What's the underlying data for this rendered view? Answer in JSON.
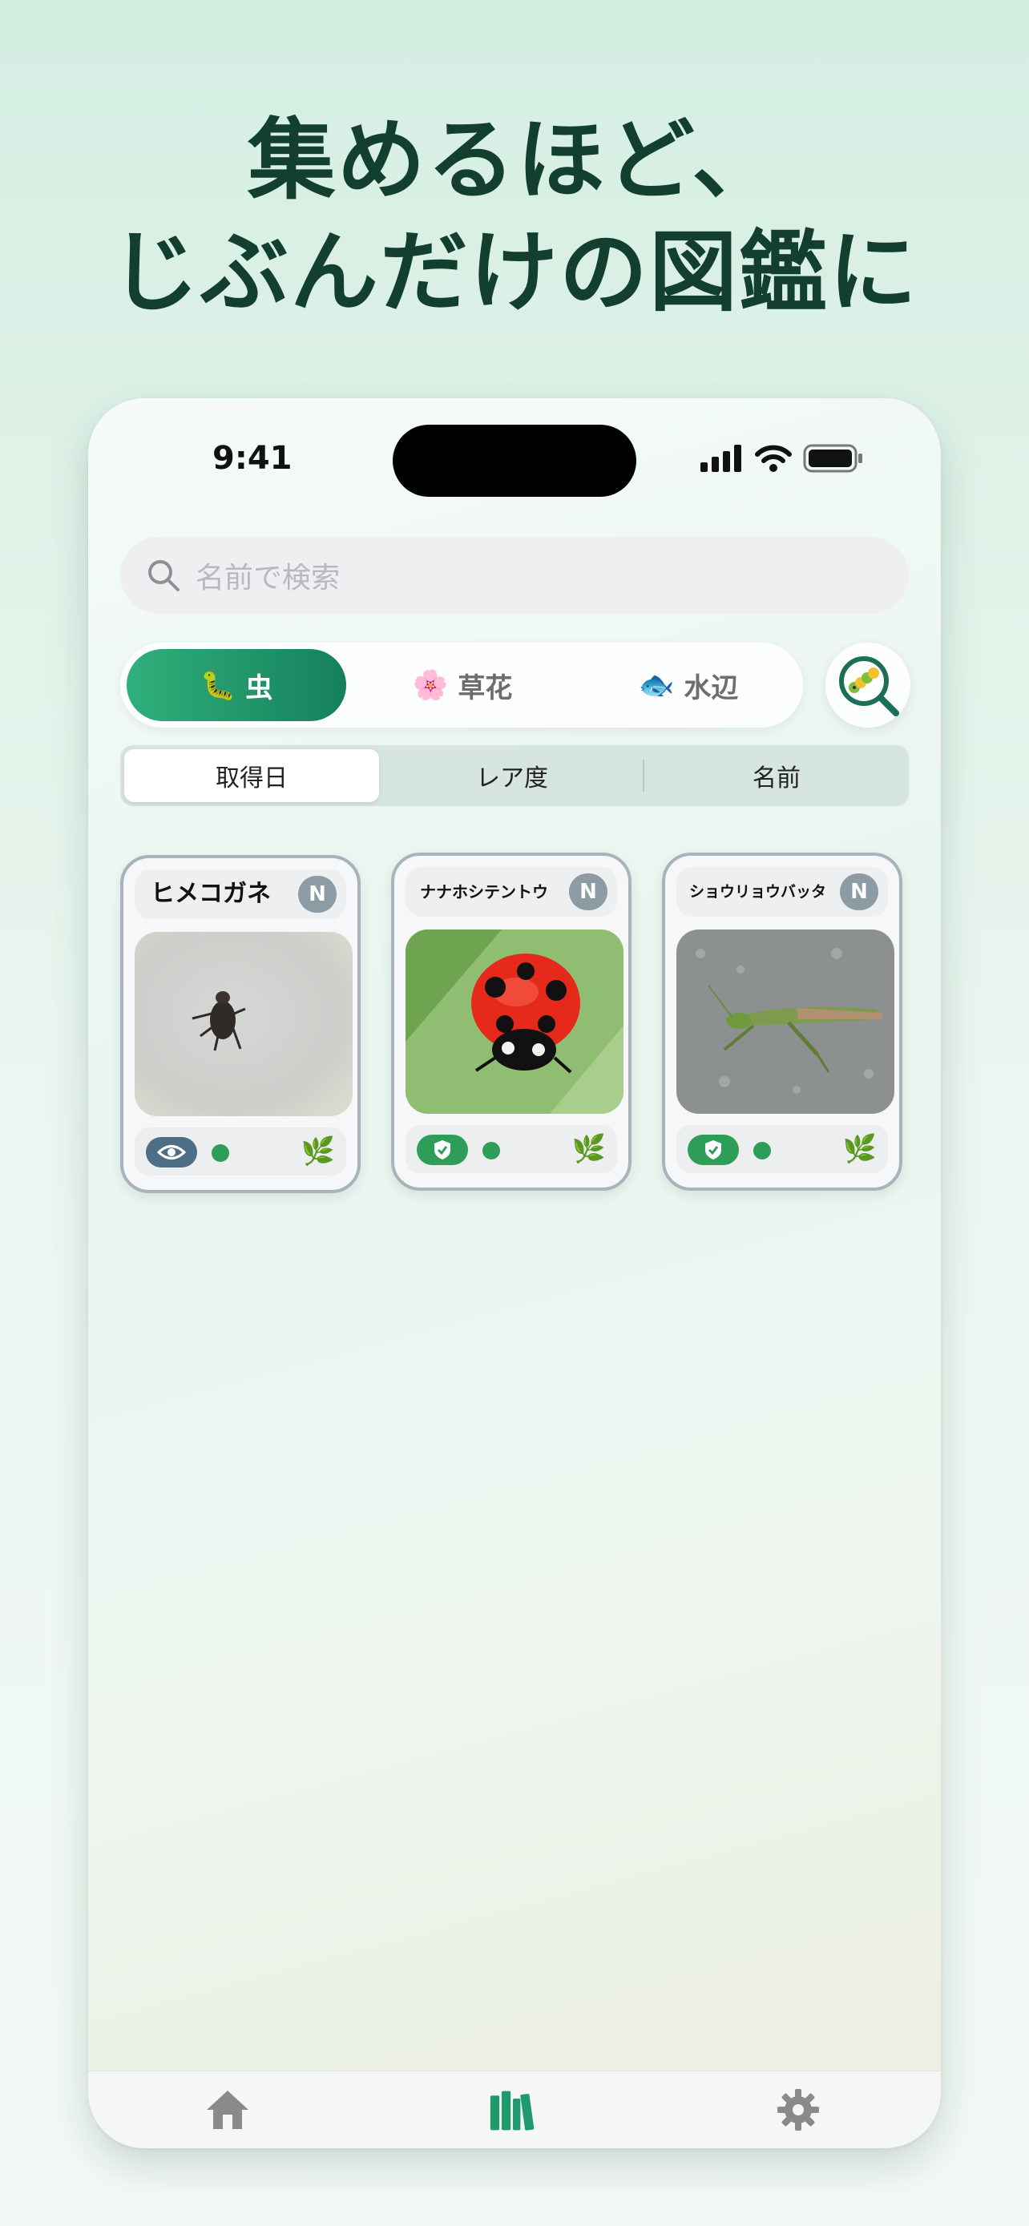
{
  "headline": {
    "line1": "集めるほど、",
    "line2": "じぶんだけの図鑑に"
  },
  "status": {
    "time": "9:41"
  },
  "search": {
    "placeholder": "名前で検索"
  },
  "category_tabs": [
    {
      "emoji": "🐛",
      "label": "虫",
      "active": true
    },
    {
      "emoji": "🌸",
      "label": "草花",
      "active": false
    },
    {
      "emoji": "🐟",
      "label": "水辺",
      "active": false
    }
  ],
  "sort_tabs": [
    {
      "label": "取得日",
      "active": true
    },
    {
      "label": "レア度",
      "active": false
    },
    {
      "label": "名前",
      "active": false
    }
  ],
  "cards": [
    {
      "name": "ヒメコガネ",
      "rarity": "N",
      "status_icon": "eye-icon",
      "leaf": "🌿"
    },
    {
      "name": "ナナホシテントウ",
      "rarity": "N",
      "status_icon": "shield-check-icon",
      "leaf": "🌿"
    },
    {
      "name": "ショウリョウバッタ",
      "rarity": "N",
      "status_icon": "shield-check-icon",
      "leaf": "🌿"
    }
  ],
  "tab_bar": [
    {
      "icon": "home-icon",
      "active": false
    },
    {
      "icon": "books-icon",
      "active": true
    },
    {
      "icon": "gear-icon",
      "active": false
    }
  ],
  "colors": {
    "accent": "#1f9a6c",
    "headline": "#123f30",
    "rarity_badge": "#8d9ca4"
  }
}
